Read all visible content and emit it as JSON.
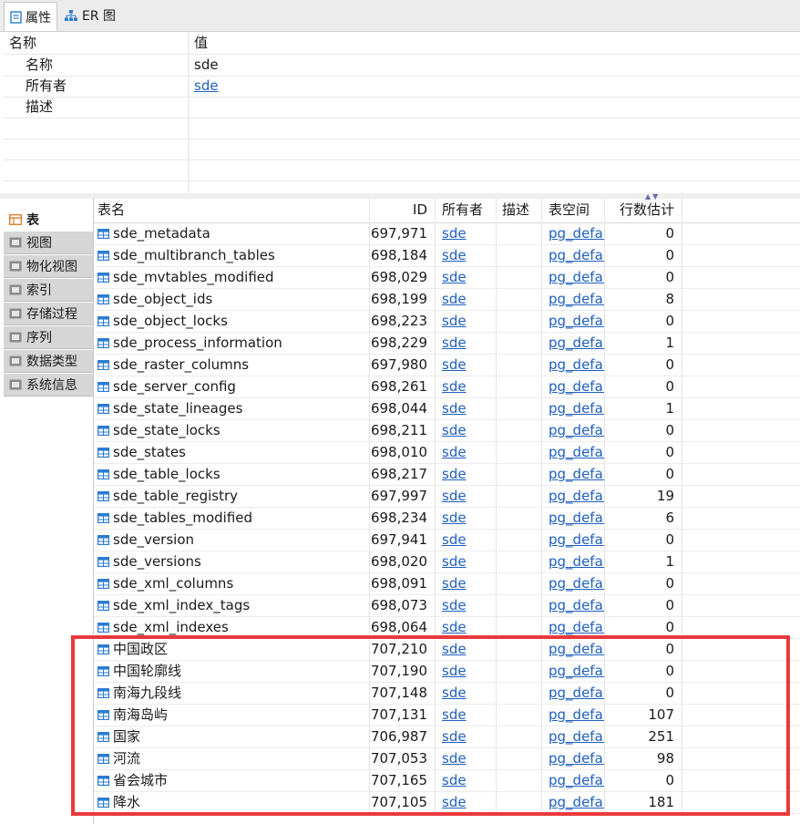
{
  "tabs": [
    {
      "label": "属性",
      "icon": "properties-icon",
      "active": true
    },
    {
      "label": "ER 图",
      "icon": "er-diagram-icon",
      "active": false
    }
  ],
  "properties": {
    "header": {
      "name": "名称",
      "value": "值"
    },
    "rows": [
      {
        "key": "名称",
        "value": "sde",
        "link": false
      },
      {
        "key": "所有者",
        "value": "sde",
        "link": true
      },
      {
        "key": "描述",
        "value": "",
        "link": false
      }
    ]
  },
  "categories": [
    {
      "label": "表",
      "icon": "table-icon",
      "active": true
    },
    {
      "label": "视图",
      "icon": "view-icon",
      "active": false
    },
    {
      "label": "物化视图",
      "icon": "materialized-view-icon",
      "active": false
    },
    {
      "label": "索引",
      "icon": "index-icon",
      "active": false
    },
    {
      "label": "存储过程",
      "icon": "procedure-icon",
      "active": false
    },
    {
      "label": "序列",
      "icon": "sequence-icon",
      "active": false
    },
    {
      "label": "数据类型",
      "icon": "datatype-icon",
      "active": false
    },
    {
      "label": "系统信息",
      "icon": "sysinfo-icon",
      "active": false
    }
  ],
  "table": {
    "columns": [
      "表名",
      "ID",
      "所有者",
      "描述",
      "表空间",
      "行数估计"
    ],
    "rows": [
      {
        "name": "sde_metadata",
        "id": "697,971",
        "owner": "sde",
        "desc": "",
        "space": "pg_default",
        "rows": "0"
      },
      {
        "name": "sde_multibranch_tables",
        "id": "698,184",
        "owner": "sde",
        "desc": "",
        "space": "pg_default",
        "rows": "0"
      },
      {
        "name": "sde_mvtables_modified",
        "id": "698,029",
        "owner": "sde",
        "desc": "",
        "space": "pg_default",
        "rows": "0"
      },
      {
        "name": "sde_object_ids",
        "id": "698,199",
        "owner": "sde",
        "desc": "",
        "space": "pg_default",
        "rows": "8"
      },
      {
        "name": "sde_object_locks",
        "id": "698,223",
        "owner": "sde",
        "desc": "",
        "space": "pg_default",
        "rows": "0"
      },
      {
        "name": "sde_process_information",
        "id": "698,229",
        "owner": "sde",
        "desc": "",
        "space": "pg_default",
        "rows": "1"
      },
      {
        "name": "sde_raster_columns",
        "id": "697,980",
        "owner": "sde",
        "desc": "",
        "space": "pg_default",
        "rows": "0"
      },
      {
        "name": "sde_server_config",
        "id": "698,261",
        "owner": "sde",
        "desc": "",
        "space": "pg_default",
        "rows": "0"
      },
      {
        "name": "sde_state_lineages",
        "id": "698,044",
        "owner": "sde",
        "desc": "",
        "space": "pg_default",
        "rows": "1"
      },
      {
        "name": "sde_state_locks",
        "id": "698,211",
        "owner": "sde",
        "desc": "",
        "space": "pg_default",
        "rows": "0"
      },
      {
        "name": "sde_states",
        "id": "698,010",
        "owner": "sde",
        "desc": "",
        "space": "pg_default",
        "rows": "0"
      },
      {
        "name": "sde_table_locks",
        "id": "698,217",
        "owner": "sde",
        "desc": "",
        "space": "pg_default",
        "rows": "0"
      },
      {
        "name": "sde_table_registry",
        "id": "697,997",
        "owner": "sde",
        "desc": "",
        "space": "pg_default",
        "rows": "19"
      },
      {
        "name": "sde_tables_modified",
        "id": "698,234",
        "owner": "sde",
        "desc": "",
        "space": "pg_default",
        "rows": "6"
      },
      {
        "name": "sde_version",
        "id": "697,941",
        "owner": "sde",
        "desc": "",
        "space": "pg_default",
        "rows": "0"
      },
      {
        "name": "sde_versions",
        "id": "698,020",
        "owner": "sde",
        "desc": "",
        "space": "pg_default",
        "rows": "1"
      },
      {
        "name": "sde_xml_columns",
        "id": "698,091",
        "owner": "sde",
        "desc": "",
        "space": "pg_default",
        "rows": "0"
      },
      {
        "name": "sde_xml_index_tags",
        "id": "698,073",
        "owner": "sde",
        "desc": "",
        "space": "pg_default",
        "rows": "0"
      },
      {
        "name": "sde_xml_indexes",
        "id": "698,064",
        "owner": "sde",
        "desc": "",
        "space": "pg_default",
        "rows": "0"
      },
      {
        "name": "中国政区",
        "id": "707,210",
        "owner": "sde",
        "desc": "",
        "space": "pg_default",
        "rows": "0"
      },
      {
        "name": "中国轮廓线",
        "id": "707,190",
        "owner": "sde",
        "desc": "",
        "space": "pg_default",
        "rows": "0"
      },
      {
        "name": "南海九段线",
        "id": "707,148",
        "owner": "sde",
        "desc": "",
        "space": "pg_default",
        "rows": "0"
      },
      {
        "name": "南海岛屿",
        "id": "707,131",
        "owner": "sde",
        "desc": "",
        "space": "pg_default",
        "rows": "107"
      },
      {
        "name": "国家",
        "id": "706,987",
        "owner": "sde",
        "desc": "",
        "space": "pg_default",
        "rows": "251"
      },
      {
        "name": "河流",
        "id": "707,053",
        "owner": "sde",
        "desc": "",
        "space": "pg_default",
        "rows": "98"
      },
      {
        "name": "省会城市",
        "id": "707,165",
        "owner": "sde",
        "desc": "",
        "space": "pg_default",
        "rows": "0"
      },
      {
        "name": "降水",
        "id": "707,105",
        "owner": "sde",
        "desc": "",
        "space": "pg_default",
        "rows": "181"
      }
    ]
  },
  "colors": {
    "link": "#1f5fbf",
    "highlight": "#e8393c",
    "table_icon": "#2b7cd3"
  }
}
